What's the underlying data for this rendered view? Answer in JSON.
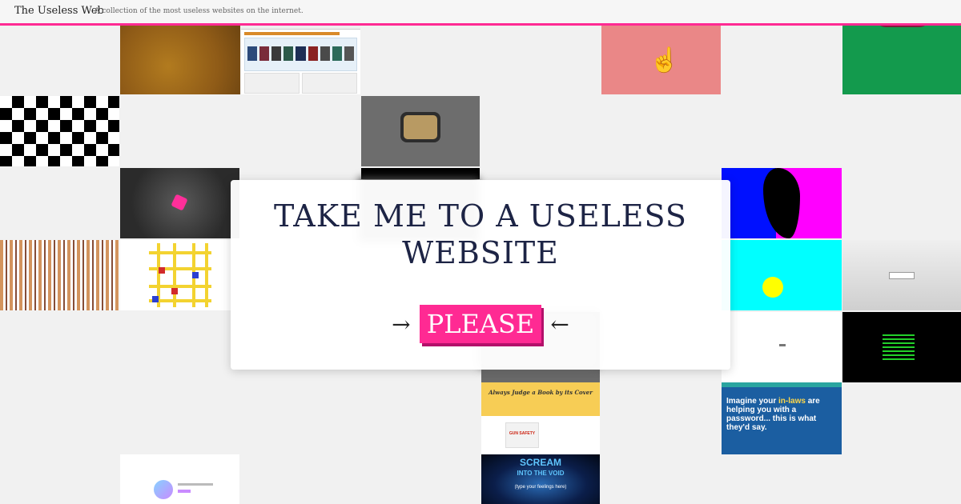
{
  "header": {
    "brand": "The Useless Web",
    "tagline": "A collection of the most useless websites on the internet."
  },
  "tiles": {
    "book_title": "Always Judge a Book by its Cover",
    "gun_safety": "GUN SAFETY",
    "inlaws_pre": "Imagine your ",
    "inlaws_hl": "in-laws",
    "inlaws_post": " are helping you with a password... this is what they'd say.",
    "scream_1": "SCREAM",
    "scream_2": "INTO THE VOID",
    "scream_prompt": "(type your feelings here)"
  },
  "modal": {
    "heading": "TAKE ME TO A USELESS WEBSITE",
    "arrow_left": "→",
    "arrow_right": "←",
    "cta": "PLEASE"
  },
  "colors": {
    "accent": "#ff2a93",
    "heading": "#1d2445"
  },
  "icons": [
    "pointing-hand-icon"
  ]
}
